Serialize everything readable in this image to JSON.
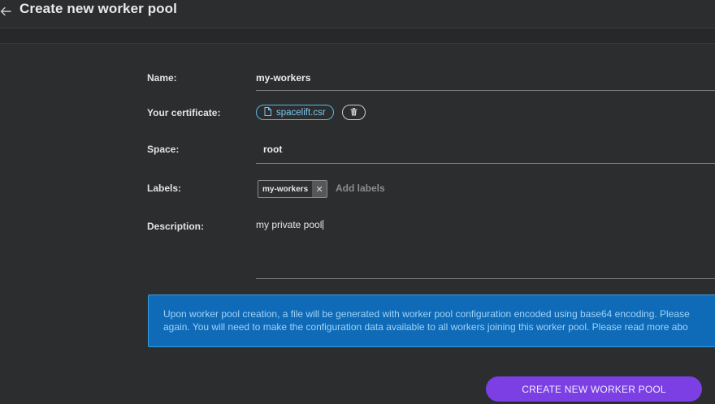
{
  "header": {
    "title": "Create new worker pool"
  },
  "form": {
    "name_label": "Name:",
    "name_value": "my-workers",
    "certificate_label": "Your certificate:",
    "certificate_file": "spacelift.csr",
    "space_label": "Space:",
    "space_value": "root",
    "labels_label": "Labels:",
    "label_tags": [
      "my-workers"
    ],
    "labels_placeholder": "Add labels",
    "description_label": "Description:",
    "description_value": "my private pool"
  },
  "info": {
    "line1": "Upon worker pool creation, a file will be generated with worker pool configuration encoded using base64 encoding. Please",
    "line2": "again. You will need to make the configuration data available to all workers joining this worker pool. Please read more abo"
  },
  "actions": {
    "create_label": "CREATE NEW WORKER POOL"
  },
  "colors": {
    "background": "#2c2d2e",
    "accent_blue": "#58b8e8",
    "info_bg": "#0f6bb8",
    "primary_button": "#7b3fe4"
  }
}
